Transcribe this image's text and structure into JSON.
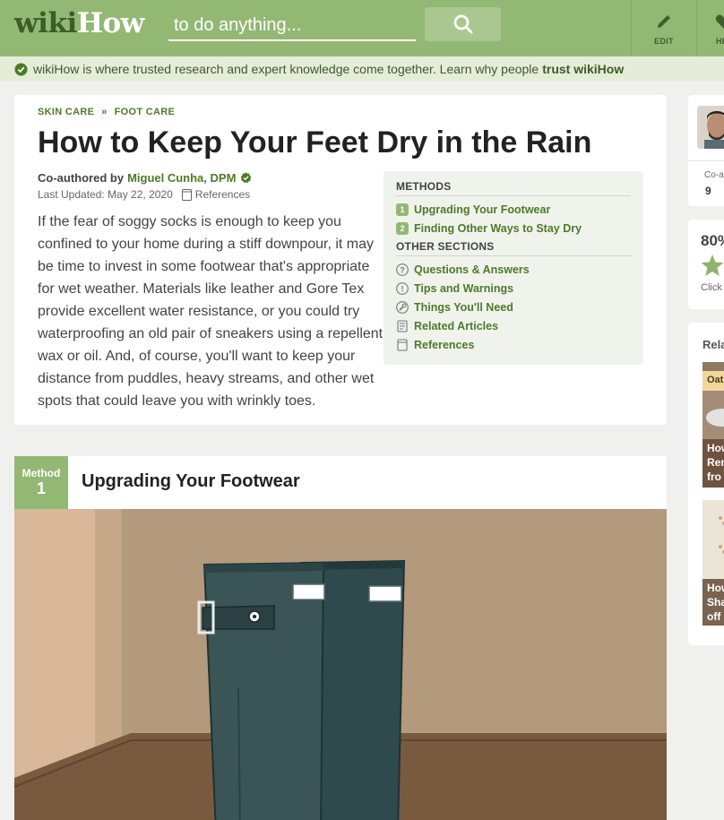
{
  "header": {
    "logo_wiki": "wiki",
    "logo_how": "How",
    "search_placeholder": "to do anything...",
    "edit_label": "EDIT",
    "help_label": "HEL"
  },
  "trust_bar": {
    "text": "wikiHow is where trusted research and expert knowledge come together. Learn why people",
    "link": "trust wikiHow"
  },
  "article": {
    "breadcrumbs": [
      "SKIN CARE",
      "FOOT CARE"
    ],
    "breadcrumb_sep": "»",
    "title": "How to Keep Your Feet Dry in the Rain",
    "coauthored_prefix": "Co-authored by",
    "author": "Miguel Cunha, DPM",
    "last_updated": "Last Updated: May 22, 2020",
    "references_link": "References",
    "intro": "If the fear of soggy socks is enough to keep you confined to your home during a stiff downpour, it may be time to invest in some footwear that's appropriate for wet weather. Materials like leather and Gore Tex provide excellent water resistance, or you could try waterproofing an old pair of sneakers using a repellent wax or oil. And, of course, you'll want to keep your distance from puddles, heavy streams, and other wet spots that could leave you with wrinkly toes."
  },
  "toc": {
    "methods_heading": "METHODS",
    "methods": [
      {
        "num": "1",
        "label": "Upgrading Your Footwear"
      },
      {
        "num": "2",
        "label": "Finding Other Ways to Stay Dry"
      }
    ],
    "other_heading": "OTHER SECTIONS",
    "other": [
      {
        "icon": "question-icon",
        "label": "Questions & Answers"
      },
      {
        "icon": "warning-icon",
        "label": "Tips and Warnings"
      },
      {
        "icon": "wrench-icon",
        "label": "Things You'll Need"
      },
      {
        "icon": "related-icon",
        "label": "Related Articles"
      },
      {
        "icon": "references-icon",
        "label": "References"
      }
    ]
  },
  "method": {
    "tag": "Method",
    "number": "1",
    "title": "Upgrading Your Footwear"
  },
  "sidebar": {
    "coauthor_label": "Co-a",
    "coauthor_count": "9",
    "rating_pct": "80%",
    "rating_click": "Click",
    "related_heading": "Rela",
    "related": [
      {
        "banner": "Oat",
        "lines": [
          "How",
          "Rem",
          "fro"
        ]
      },
      {
        "lines": [
          "How",
          "Sha",
          "off"
        ]
      }
    ]
  },
  "colors": {
    "brand_green": "#93b874",
    "dark_green": "#4d7a2a",
    "trust_bg": "#e5edd9"
  }
}
